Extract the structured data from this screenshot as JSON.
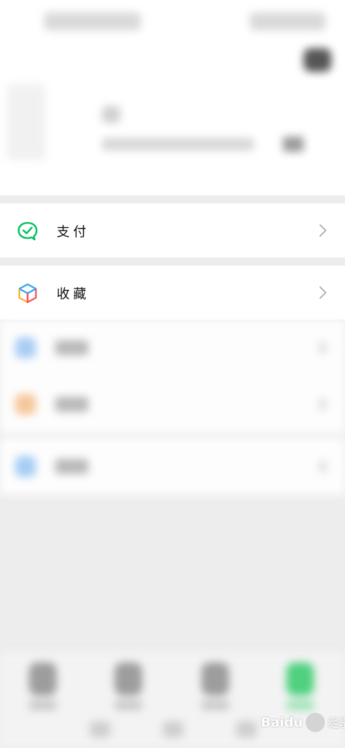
{
  "menu": {
    "pay": {
      "label": "支付",
      "icon": "wechat-pay-icon",
      "accent": "#07c160"
    },
    "favorites": {
      "label": "收藏",
      "icon": "favorites-cube-icon"
    }
  },
  "watermark": {
    "brand": "Baidu",
    "suffix": "经验"
  },
  "colors": {
    "background": "#ededed",
    "row": "#ffffff",
    "text": "#111111",
    "chevron": "#b2b2b2"
  }
}
